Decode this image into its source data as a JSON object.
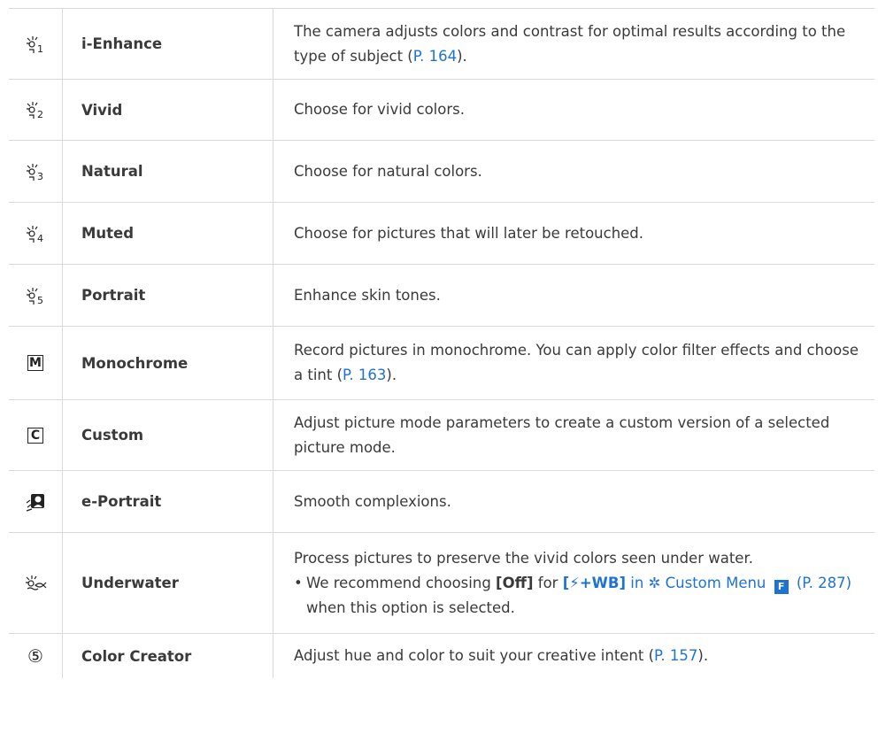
{
  "rows": [
    {
      "name": "i-Enhance",
      "icon": "picture-mode-1-icon",
      "desc_pre": "The camera adjusts colors and contrast for optimal results according to the type of subject (",
      "link": "P. 164",
      "desc_post": ")."
    },
    {
      "name": "Vivid",
      "icon": "picture-mode-2-icon",
      "desc": "Choose for vivid colors."
    },
    {
      "name": "Natural",
      "icon": "picture-mode-3-icon",
      "desc": "Choose for natural colors."
    },
    {
      "name": "Muted",
      "icon": "picture-mode-4-icon",
      "desc": "Choose for pictures that will later be retouched."
    },
    {
      "name": "Portrait",
      "icon": "picture-mode-5-icon",
      "desc": "Enhance skin tones."
    },
    {
      "name": "Monochrome",
      "icon": "monochrome-M-icon",
      "icon_text": "M",
      "desc_pre": "Record pictures in monochrome. You can apply color filter effects and choose a tint (",
      "link": "P. 163",
      "desc_post": ")."
    },
    {
      "name": "Custom",
      "icon": "custom-C-icon",
      "icon_text": "C",
      "desc": "Adjust picture mode parameters to create a custom version of a selected picture mode."
    },
    {
      "name": "e-Portrait",
      "icon": "e-portrait-icon",
      "desc": "Smooth complexions."
    },
    {
      "name": "Underwater",
      "icon": "underwater-icon",
      "desc": "Process pictures to preserve the vivid colors seen under water.",
      "bullet": "•",
      "note_pre": "We recommend choosing ",
      "note_off": "[Off]",
      "note_for": " for ",
      "note_wb": "[⚡+WB]",
      "note_in": " in ",
      "note_gear": "✲",
      "note_menu": " Custom Menu ",
      "note_f": "F",
      "note_link": " (P. 287)",
      "note_post": " when this option is selected."
    },
    {
      "name": "Color Creator",
      "icon": "color-creator-icon",
      "icon_text": "⑤",
      "desc_pre": "Adjust hue and color to suit your creative intent (",
      "link": "P. 157",
      "desc_post": ")."
    }
  ],
  "colors": {
    "link": "#1e73d2",
    "border": "#d9d9d9",
    "text": "#3a3a3a"
  }
}
